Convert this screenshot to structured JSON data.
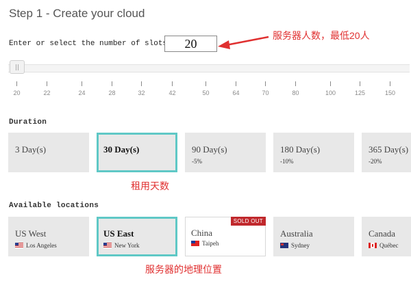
{
  "page": {
    "title": "Step 1 - Create your cloud"
  },
  "slots": {
    "label": "Enter or select the number of slots",
    "value": "20",
    "ticks": [
      "20",
      "22",
      "24",
      "28",
      "32",
      "42",
      "50",
      "64",
      "70",
      "80",
      "100",
      "125",
      "150"
    ],
    "selected_value": 20
  },
  "annotations": {
    "slots": "服务器人数，最低20人",
    "duration": "租用天数",
    "locations": "服务器的地理位置",
    "color": "#e03030"
  },
  "duration": {
    "heading": "Duration",
    "options": [
      {
        "label": "3 Day(s)",
        "discount": "",
        "selected": false
      },
      {
        "label": "30 Day(s)",
        "discount": "",
        "selected": true
      },
      {
        "label": "90 Day(s)",
        "discount": "-5%",
        "selected": false
      },
      {
        "label": "180 Day(s)",
        "discount": "-10%",
        "selected": false
      },
      {
        "label": "365 Day(s)",
        "discount": "-20%",
        "selected": false
      }
    ]
  },
  "locations": {
    "heading": "Available locations",
    "options": [
      {
        "name": "US West",
        "city": "Los Angeles",
        "flag": "flag-us-icon",
        "selected": false,
        "sold_out": false
      },
      {
        "name": "US East",
        "city": "New York",
        "flag": "flag-us-icon",
        "selected": true,
        "sold_out": false
      },
      {
        "name": "China",
        "city": "Taipeh",
        "flag": "flag-taiwan-icon",
        "selected": false,
        "sold_out": true,
        "badge": "SOLD OUT"
      },
      {
        "name": "Australia",
        "city": "Sydney",
        "flag": "flag-australia-icon",
        "selected": false,
        "sold_out": false
      },
      {
        "name": "Canada",
        "city": "Québec",
        "flag": "flag-canada-icon",
        "selected": false,
        "sold_out": false
      }
    ]
  },
  "colors": {
    "selected_border": "#5fc8c6",
    "card_bg": "#e8e8e8",
    "sold_out_badge": "#c0282c"
  }
}
